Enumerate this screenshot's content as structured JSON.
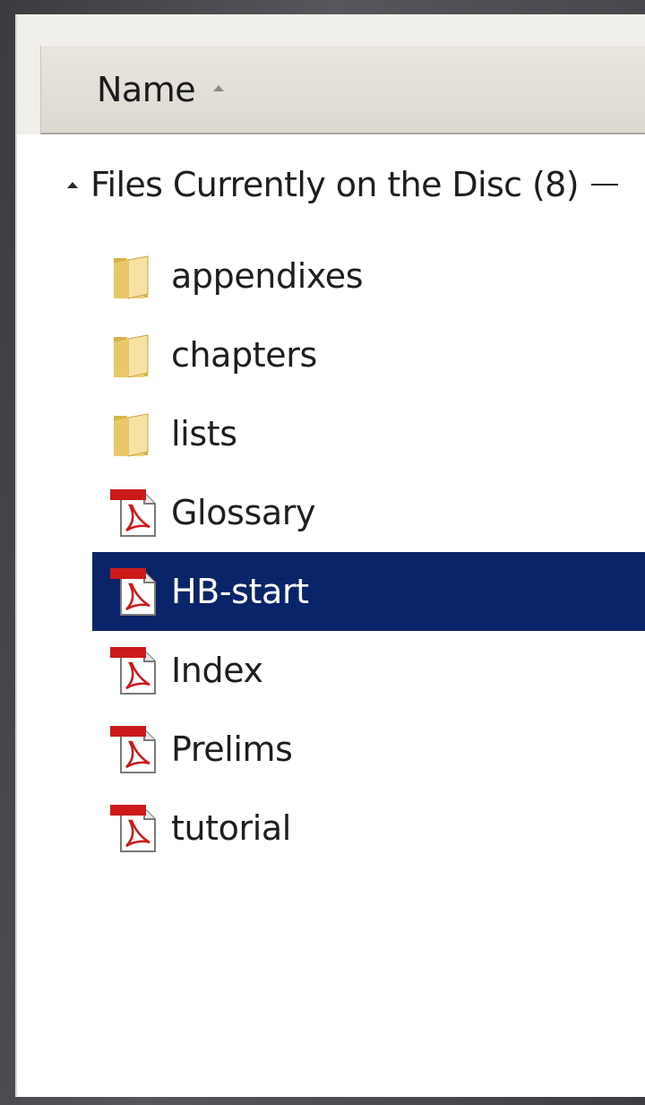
{
  "column_header": {
    "name_label": "Name"
  },
  "group": {
    "label": "Files Currently on the Disc (8)"
  },
  "files": [
    {
      "label": "appendixes",
      "icon": "folder-icon",
      "selected": false
    },
    {
      "label": "chapters",
      "icon": "folder-icon",
      "selected": false
    },
    {
      "label": "lists",
      "icon": "folder-icon",
      "selected": false
    },
    {
      "label": "Glossary",
      "icon": "pdf-icon",
      "selected": false
    },
    {
      "label": "HB-start",
      "icon": "pdf-icon",
      "selected": true
    },
    {
      "label": "Index",
      "icon": "pdf-icon",
      "selected": false
    },
    {
      "label": "Prelims",
      "icon": "pdf-icon",
      "selected": false
    },
    {
      "label": "tutorial",
      "icon": "pdf-icon",
      "selected": false
    }
  ],
  "colors": {
    "selection": "#0a246a",
    "folder": "#f2d27a",
    "pdf_accent": "#cc1a1a"
  }
}
